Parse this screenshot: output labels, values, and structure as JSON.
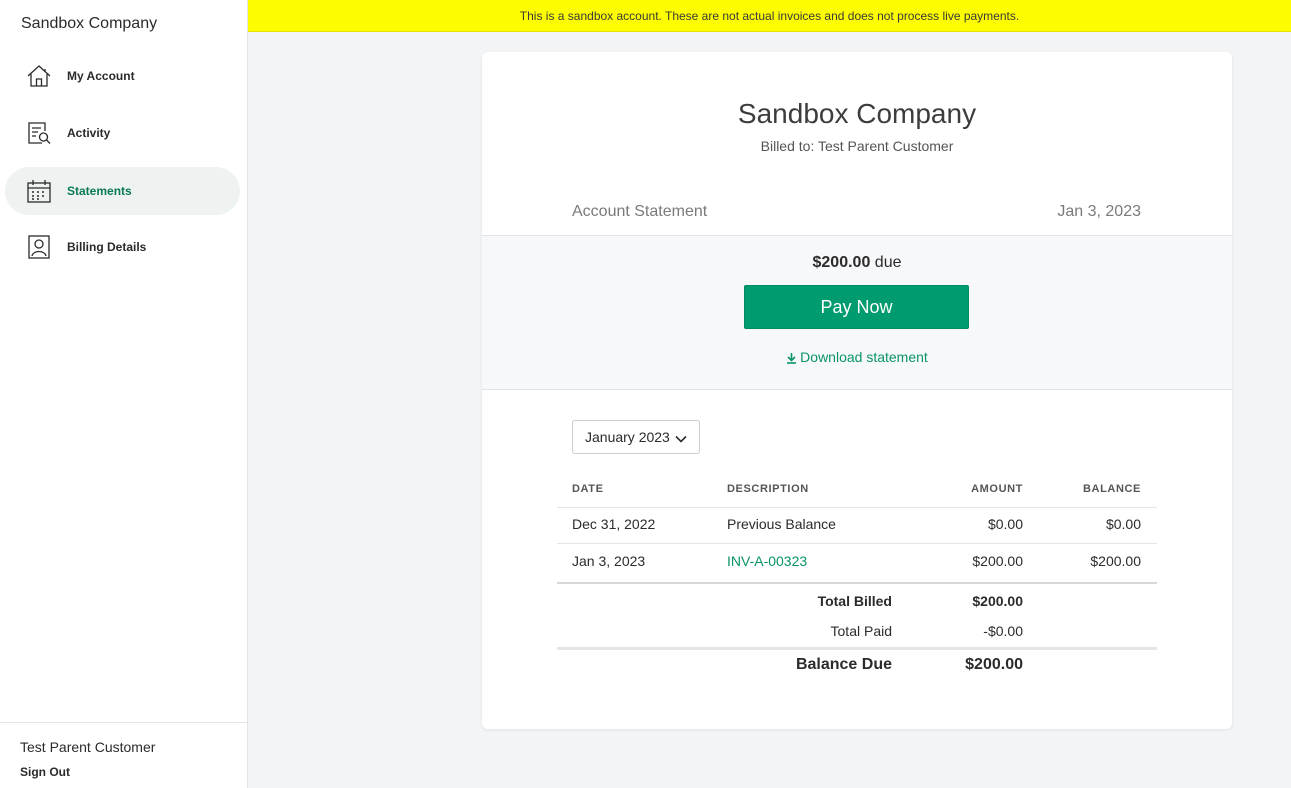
{
  "sidebar": {
    "brand": "Sandbox Company",
    "items": [
      {
        "label": "My Account",
        "icon": "home-icon"
      },
      {
        "label": "Activity",
        "icon": "search-document-icon"
      },
      {
        "label": "Statements",
        "icon": "calendar-icon"
      },
      {
        "label": "Billing Details",
        "icon": "person-card-icon"
      }
    ],
    "active_item": "Statements",
    "footer": {
      "customer_name": "Test Parent Customer",
      "sign_out": "Sign Out"
    }
  },
  "banner": {
    "text": "This is a sandbox account. These are not actual invoices and does not process live payments."
  },
  "statement": {
    "company": "Sandbox Company",
    "billed_to": "Billed to: Test Parent Customer",
    "label": "Account Statement",
    "date": "Jan 3, 2023",
    "due_amount": "$200.00",
    "due_suffix": "due",
    "pay_button": "Pay Now",
    "download_label": "Download statement",
    "month_select": "January 2023"
  },
  "table": {
    "headers": [
      "DATE",
      "DESCRIPTION",
      "AMOUNT",
      "BALANCE"
    ],
    "rows": [
      {
        "date": "Dec 31, 2022",
        "description": "Previous Balance",
        "amount": "$0.00",
        "balance": "$0.00",
        "is_link": false
      },
      {
        "date": "Jan 3, 2023",
        "description": "INV-A-00323",
        "amount": "$200.00",
        "balance": "$200.00",
        "is_link": true
      }
    ],
    "summary": {
      "total_billed_label": "Total Billed",
      "total_billed": "$200.00",
      "total_paid_label": "Total Paid",
      "total_paid": "-$0.00",
      "balance_due_label": "Balance Due",
      "balance_due": "$200.00"
    }
  },
  "colors": {
    "accent": "#009b6e",
    "banner": "#fdfd00",
    "link": "#0a9466"
  }
}
